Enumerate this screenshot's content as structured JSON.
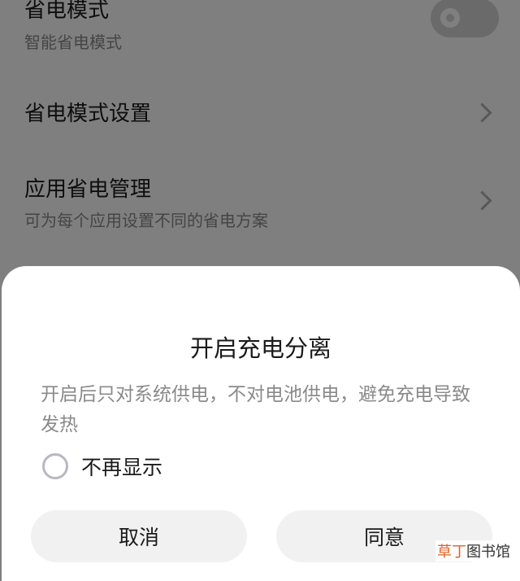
{
  "settings": {
    "power_saving_mode": {
      "title": "省电模式",
      "subtitle": "智能省电模式",
      "toggle_on": false
    },
    "power_saving_settings": {
      "title": "省电模式设置"
    },
    "app_power_management": {
      "title": "应用省电管理",
      "subtitle": "可为每个应用设置不同的省电方案"
    }
  },
  "dialog": {
    "title": "开启充电分离",
    "message": "开启后只对系统供电，不对电池供电，避免充电导致发热",
    "checkbox_label": "不再显示",
    "checkbox_checked": false,
    "cancel_label": "取消",
    "confirm_label": "同意"
  },
  "watermark": {
    "accent": "草丁",
    "rest": "图书馆"
  },
  "colors": {
    "scrim": "rgba(0,0,0,0.5)",
    "button_bg": "#f1f1f1",
    "watermark_accent": "#e0632a"
  }
}
